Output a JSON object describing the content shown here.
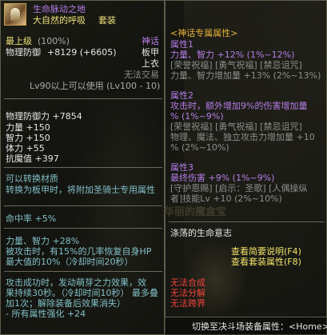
{
  "item": {
    "name": "生命脉动之地",
    "set_name": "大自然的呼吸",
    "set_tag": "套装",
    "level_label": "最上级",
    "level_pct": "(100%)",
    "rarity": "神话",
    "defense_label": "物理防御",
    "defense_value": "+8129 (+6605)",
    "slot_type": "板甲",
    "slot": "上衣",
    "tradable": "无法交易",
    "level_req": "Lv90以上可以使用 (Lv100 - 10)"
  },
  "stats": {
    "phys_def": "物理防御力 +7854",
    "str": "力量 +150",
    "int": "智力 +150",
    "vit": "体力 +55",
    "resist": "抗魔值 +397"
  },
  "convert": {
    "line1": "可以转换材质",
    "line2": "转换为板甲时，将附加圣骑士专用属性"
  },
  "hit": "命中率 +5%",
  "effects": {
    "l1": "力量、智力 +28%",
    "l2": "被攻击时，有15%的几率恢复自身HP",
    "l3": "最大值的10%（冷却时间20秒）"
  },
  "proc": {
    "l1": "攻击成功时，发动萌芽之力效果，效",
    "l2": "果持续30秒。（冷却时间10秒） 最多叠",
    "l3": "加1次；解除装备后效果消失）",
    "l4": "- 所有属性强化 +24"
  },
  "myth": {
    "header": "<神话专属属性>",
    "a1_title": "属性1",
    "a1_line": "力量、智力 +12% (1%~12%)",
    "a1_b1": "[荣誉祝福] [勇气祝福] [禁忌诅咒]",
    "a1_b2": "力量、智力增加量 +13% (2%~13%)",
    "a2_title": "属性2",
    "a2_line1": "攻击时，额外增加9%的伤害增加量",
    "a2_line2": "% (1%~9%)",
    "a2_b1": "[荣誉祝福] [勇气祝福] [禁忌诅咒]",
    "a2_b2": "物理、魔法、独立攻击力增加量 +10",
    "a2_b3": "% (2%~10%)",
    "a3_title": "属性3",
    "a3_line": "最终伤害 +9% (1%~9%)",
    "a3_b1": "[守护恩赐] [启示：圣歌] [人偶操纵",
    "a3_b2": "者]技能Lv +10 (2%~10%)"
  },
  "watermark": "华丽的魔盒宝",
  "will": "涤荡的生命意志",
  "links": {
    "brief": "查看简要说明(F4)",
    "set": "查看套装属性(F8)"
  },
  "restrictions": {
    "r1": "无法合成",
    "r2": "无法分解",
    "r3": "无法跨界"
  },
  "footer": "切换至决斗场装备属性：<Home>",
  "colors": {
    "accent_purple": "#b67de8",
    "set_yellow": "#efe37a",
    "enhance_blue": "#7ea0ff",
    "restriction_red": "#f0443c"
  }
}
